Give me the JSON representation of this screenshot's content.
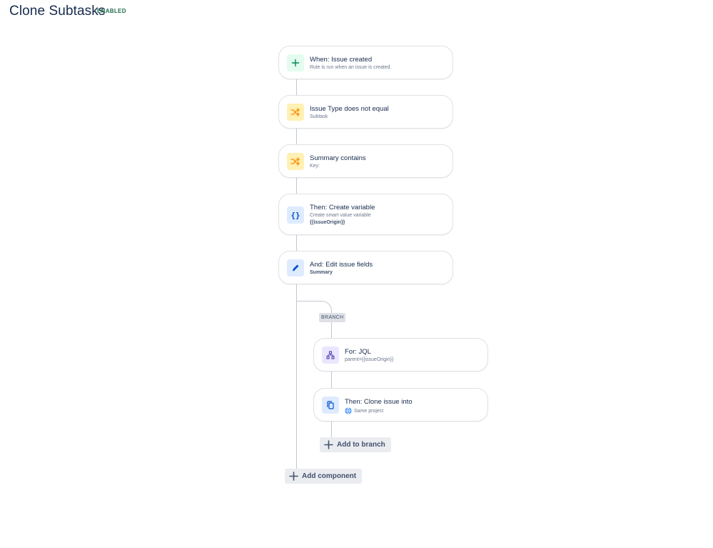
{
  "header": {
    "title": "Clone Subtasks",
    "status": "ENABLED"
  },
  "components": [
    {
      "title": "When: Issue created",
      "subtitle": "Rule is run when an issue is created.",
      "icon": "plus-icon",
      "icon_bg": "#e3fcef",
      "icon_color": "#00875a"
    },
    {
      "title": "Issue Type does not equal",
      "subtitle": "Subtask",
      "icon": "shuffle-icon",
      "icon_bg": "#fff0b3",
      "icon_color": "#ff8b00"
    },
    {
      "title": "Summary contains",
      "subtitle": "Key:",
      "icon": "shuffle-icon",
      "icon_bg": "#fff0b3",
      "icon_color": "#ff8b00"
    },
    {
      "title": "Then: Create variable",
      "subtitle": "Create smart value variable",
      "detail": "{{issueOrigin}}",
      "icon": "braces-icon",
      "icon_bg": "#deebff",
      "icon_color": "#0052cc"
    },
    {
      "title": "And: Edit issue fields",
      "subtitle": "Summary",
      "icon": "pencil-icon",
      "icon_bg": "#deebff",
      "icon_color": "#0052cc"
    }
  ],
  "branch": {
    "label": "BRANCH",
    "components": [
      {
        "title": "For: JQL",
        "subtitle": "parent={{issueOrigin}}",
        "icon": "hierarchy-icon",
        "icon_bg": "#eae6ff",
        "icon_color": "#5243aa"
      },
      {
        "title": "Then: Clone issue into",
        "subtitle": "Same project",
        "icon": "copy-icon",
        "icon_bg": "#deebff",
        "icon_color": "#0052cc"
      }
    ],
    "add_label": "Add to branch"
  },
  "add_component_label": "Add component"
}
